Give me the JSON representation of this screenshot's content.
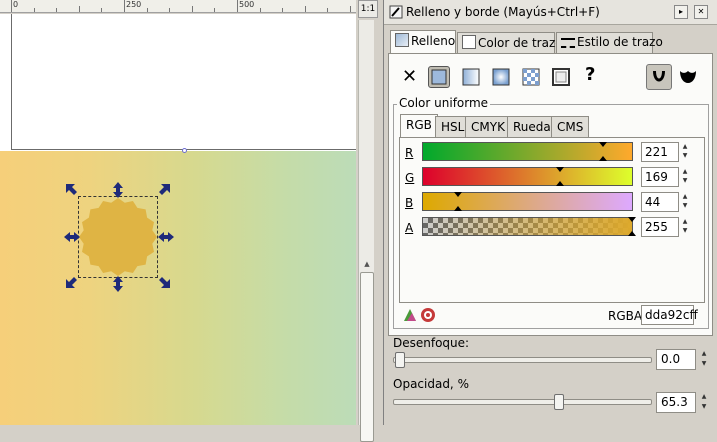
{
  "ruler": {
    "labels": [
      "0",
      "250",
      "500"
    ]
  },
  "corner_button": "1:1",
  "dialog": {
    "title": "Relleno y borde (Mayús+Ctrl+F)",
    "tabs": [
      {
        "label": "Relleno",
        "active": true
      },
      {
        "label": "Color de trazo",
        "active": false
      },
      {
        "label": "Estilo de trazo",
        "active": false
      }
    ],
    "paint_modes": {
      "none": "✕",
      "unknown": "?"
    },
    "group_label": "Color uniforme",
    "color_tabs": [
      "RGB",
      "HSL",
      "CMYK",
      "Rueda",
      "CMS"
    ],
    "channels": [
      {
        "label": "R",
        "value": "221"
      },
      {
        "label": "G",
        "value": "169"
      },
      {
        "label": "B",
        "value": "44"
      },
      {
        "label": "A",
        "value": "255"
      }
    ],
    "rgba_label": "RGBA:",
    "rgba_value": "dda92cff",
    "blur_label": "Desenfoque:",
    "blur_value": "0.0",
    "opacity_label": "Opacidad, %",
    "opacity_value": "65.3"
  },
  "colors": {
    "fill": "#dda92c",
    "gradient_left": "#f6cf7a",
    "gradient_right": "#bcdcb8",
    "handle_arrow": "#1e2a7a"
  },
  "icons": [
    "fill-stroke-icon",
    "flat-color-icon",
    "linear-gradient-icon",
    "radial-gradient-icon",
    "pattern-icon",
    "swatch-icon",
    "evenodd-icon",
    "nonzero-icon",
    "color-picker-icon",
    "color-managed-icon"
  ]
}
